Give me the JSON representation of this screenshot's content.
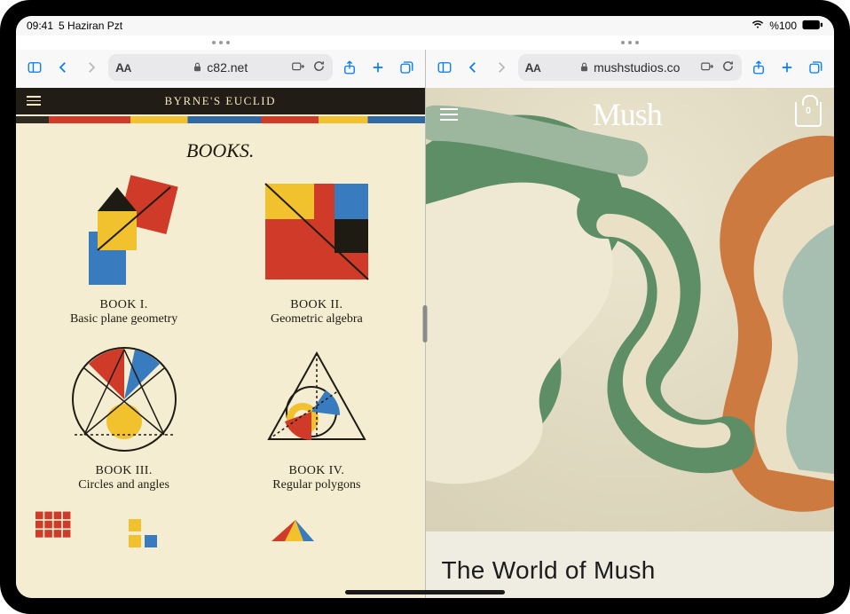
{
  "status": {
    "time": "09:41",
    "date": "5 Haziran Pzt",
    "battery_text": "%100"
  },
  "left_pane": {
    "url_display": "c82.net",
    "site": {
      "brand": "BYRNE'S EUCLID",
      "heading": "BOOKS.",
      "books": [
        {
          "label": "BOOK I.",
          "sub": "Basic plane geometry"
        },
        {
          "label": "BOOK II.",
          "sub": "Geometric algebra"
        },
        {
          "label": "BOOK III.",
          "sub": "Circles and angles"
        },
        {
          "label": "BOOK IV.",
          "sub": "Regular polygons"
        }
      ]
    }
  },
  "right_pane": {
    "url_display": "mushstudios.co",
    "site": {
      "brand": "Mush",
      "cart_count": "0",
      "headline": "The World of Mush"
    }
  }
}
